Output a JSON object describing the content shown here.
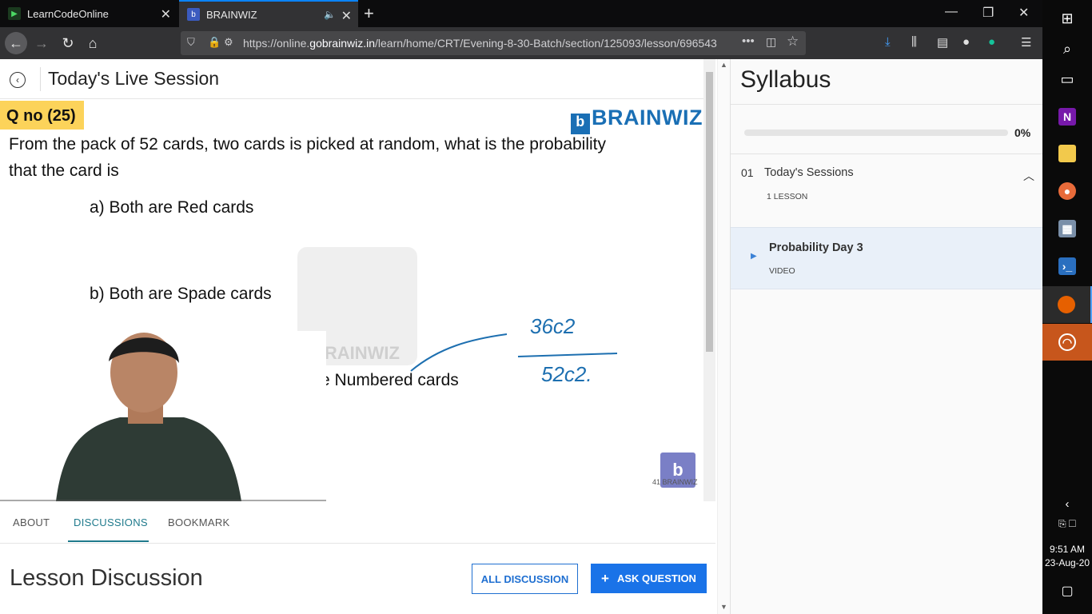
{
  "browser": {
    "tabs": [
      {
        "title": "LearnCodeOnline",
        "active": false
      },
      {
        "title": "BRAINWIZ",
        "active": true
      }
    ],
    "url_prefix": "https://online.",
    "url_domain": "gobrainwiz.in",
    "url_path": "/learn/home/CRT/Evening-8-30-Batch/section/125093/lesson/696543"
  },
  "header": {
    "title": "Today's Live Session"
  },
  "video": {
    "qno": "Q no (25)",
    "brand": "BRAINWIZ",
    "question_line1": "From the pack of 52 cards, two cards is picked at random, what is the probability",
    "question_line2": "that the card is",
    "option_a": "a) Both are Red cards",
    "option_b": "b) Both are Spade cards",
    "option_c": "c) Both are Numbered cards",
    "watermark": "BRAINWIZ",
    "handwriting_num": "36c2",
    "handwriting_den": "52c2.",
    "mini_logo_text": "41 BRAINWIZ"
  },
  "page_tabs": {
    "about": "ABOUT",
    "discussions": "DISCUSSIONS",
    "bookmark": "BOOKMARK"
  },
  "discussion": {
    "title": "Lesson Discussion",
    "all_button": "ALL DISCUSSION",
    "ask_button": "ASK QUESTION"
  },
  "syllabus": {
    "title": "Syllabus",
    "progress_pct": "0%",
    "progress_value": 0,
    "section_num": "01",
    "section_title": "Today's Sessions",
    "section_count": "1 LESSON",
    "lesson_title": "Probability Day 3",
    "lesson_type": "VIDEO"
  },
  "taskbar": {
    "time": "9:51 AM",
    "date": "23-Aug-20"
  },
  "colors": {
    "accent": "#1f7a8c",
    "primary_button": "#1a73e8",
    "highlight_yellow": "#fcd35a"
  }
}
